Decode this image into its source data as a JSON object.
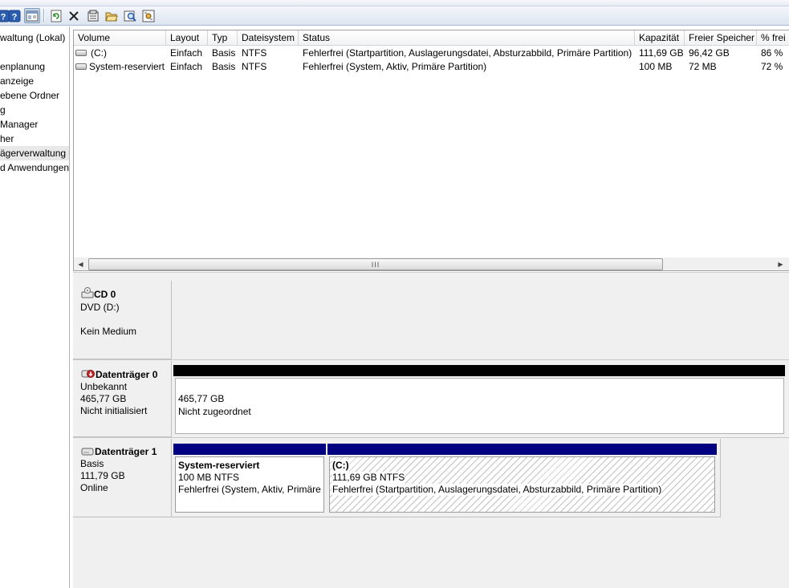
{
  "toolbar": {
    "icons": [
      "help-icon",
      "show-hide-icon",
      "refresh-icon",
      "delete-icon",
      "properties-icon",
      "open-icon",
      "explore-icon",
      "settings-icon"
    ]
  },
  "tree": {
    "items": [
      {
        "label": "waltung (Lokal)",
        "selected": false
      },
      {
        "label": "enplanung",
        "selected": false
      },
      {
        "label": "anzeige",
        "selected": false
      },
      {
        "label": "ebene Ordner",
        "selected": false
      },
      {
        "label": "g",
        "selected": false
      },
      {
        "label": "Manager",
        "selected": false
      },
      {
        "label": "her",
        "selected": false
      },
      {
        "label": "ägerverwaltung",
        "selected": true
      },
      {
        "label": "d Anwendungen",
        "selected": false
      }
    ]
  },
  "volume_list": {
    "columns": [
      "Volume",
      "Layout",
      "Typ",
      "Dateisystem",
      "Status",
      "Kapazität",
      "Freier Speicher",
      "% frei"
    ],
    "rows": [
      {
        "volume": "(C:)",
        "layout": "Einfach",
        "typ": "Basis",
        "dateisystem": "NTFS",
        "status": "Fehlerfrei (Startpartition, Auslagerungsdatei, Absturzabbild, Primäre Partition)",
        "kapazitaet": "111,69 GB",
        "frei": "96,42 GB",
        "prozent": "86 %"
      },
      {
        "volume": "System-reserviert",
        "layout": "Einfach",
        "typ": "Basis",
        "dateisystem": "NTFS",
        "status": "Fehlerfrei (System, Aktiv, Primäre Partition)",
        "kapazitaet": "100 MB",
        "frei": "72 MB",
        "prozent": "72 %"
      }
    ],
    "scrollbar_thumb_label": "III"
  },
  "disks": {
    "cd0": {
      "name": "CD 0",
      "line1": "DVD (D:)",
      "line2": "Kein Medium"
    },
    "disk0": {
      "name": "Datenträger 0",
      "line1": "Unbekannt",
      "line2": "465,77 GB",
      "line3": "Nicht initialisiert",
      "partition": {
        "size": "465,77 GB",
        "status": "Nicht zugeordnet",
        "bar_color": "#000000"
      }
    },
    "disk1": {
      "name": "Datenträger 1",
      "line1": "Basis",
      "line2": "111,79 GB",
      "line3": "Online",
      "partitions": [
        {
          "name": "System-reserviert",
          "size": "100 MB NTFS",
          "status": "Fehlerfrei (System, Aktiv, Primäre",
          "bar_color": "#000080"
        },
        {
          "name": "(C:)",
          "size": "111,69 GB NTFS",
          "status": "Fehlerfrei (Startpartition, Auslagerungsdatei, Absturzabbild, Primäre Partition)",
          "bar_color": "#000080"
        }
      ]
    }
  }
}
